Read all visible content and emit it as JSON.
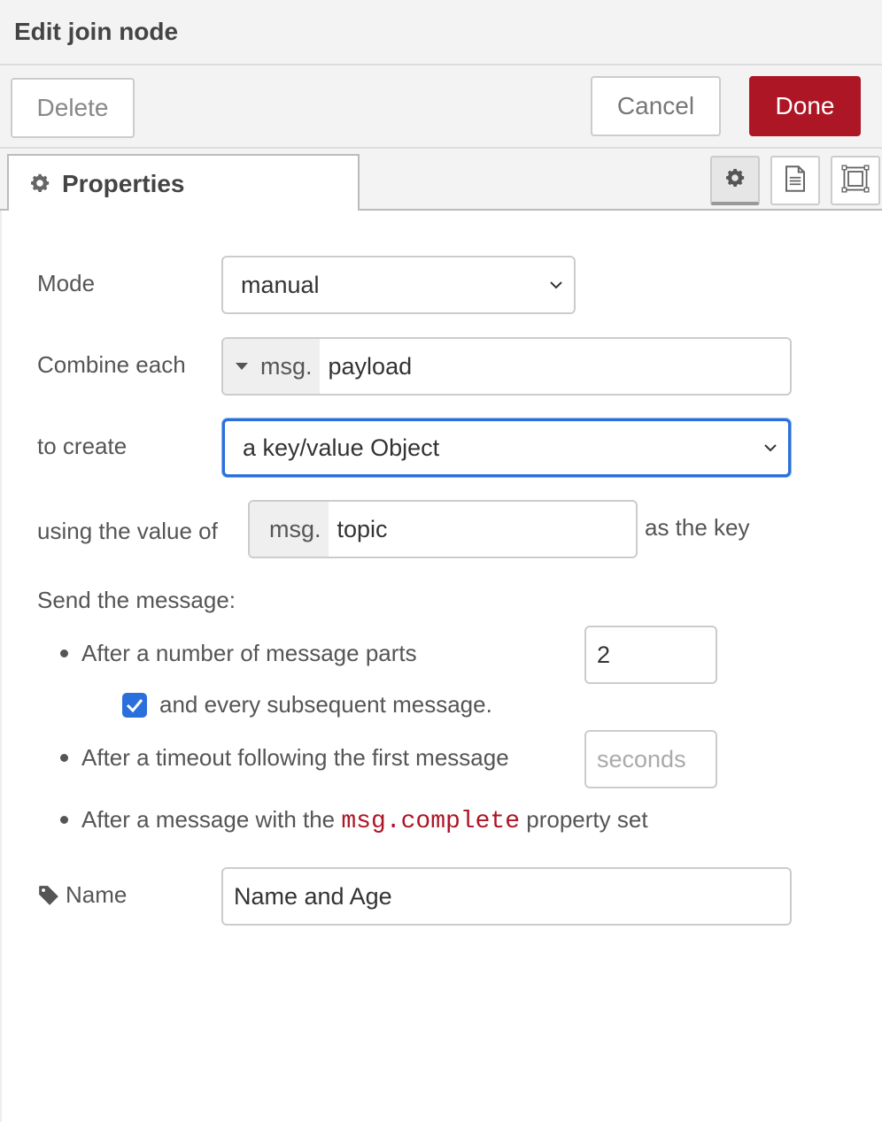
{
  "dialog": {
    "title": "Edit join node",
    "delete_label": "Delete",
    "cancel_label": "Cancel",
    "done_label": "Done"
  },
  "tabs": {
    "properties_label": "Properties"
  },
  "form": {
    "mode_label": "Mode",
    "mode_value": "manual",
    "combine_label": "Combine each",
    "combine_prefix": "msg.",
    "combine_value": "payload",
    "create_label": "to create",
    "create_value": "a key/value Object",
    "key_label": "using the value of",
    "key_prefix": "msg.",
    "key_value": "topic",
    "key_suffix": "as the key",
    "send_label": "Send the message:",
    "parts_label": "After a number of message parts",
    "parts_value": "2",
    "subsequent_label": "and every subsequent message.",
    "subsequent_checked": true,
    "timeout_label": "After a timeout following the first message",
    "timeout_placeholder": "seconds",
    "complete_prefix": "After a message with the",
    "complete_code": "msg.complete",
    "complete_suffix": "property set",
    "name_label": "Name",
    "name_value": "Name and Age"
  },
  "colors": {
    "done_button": "#ad1625",
    "focus_border": "#2a6fdb",
    "checkbox": "#2a6fdb",
    "code_text": "#ad1625"
  }
}
